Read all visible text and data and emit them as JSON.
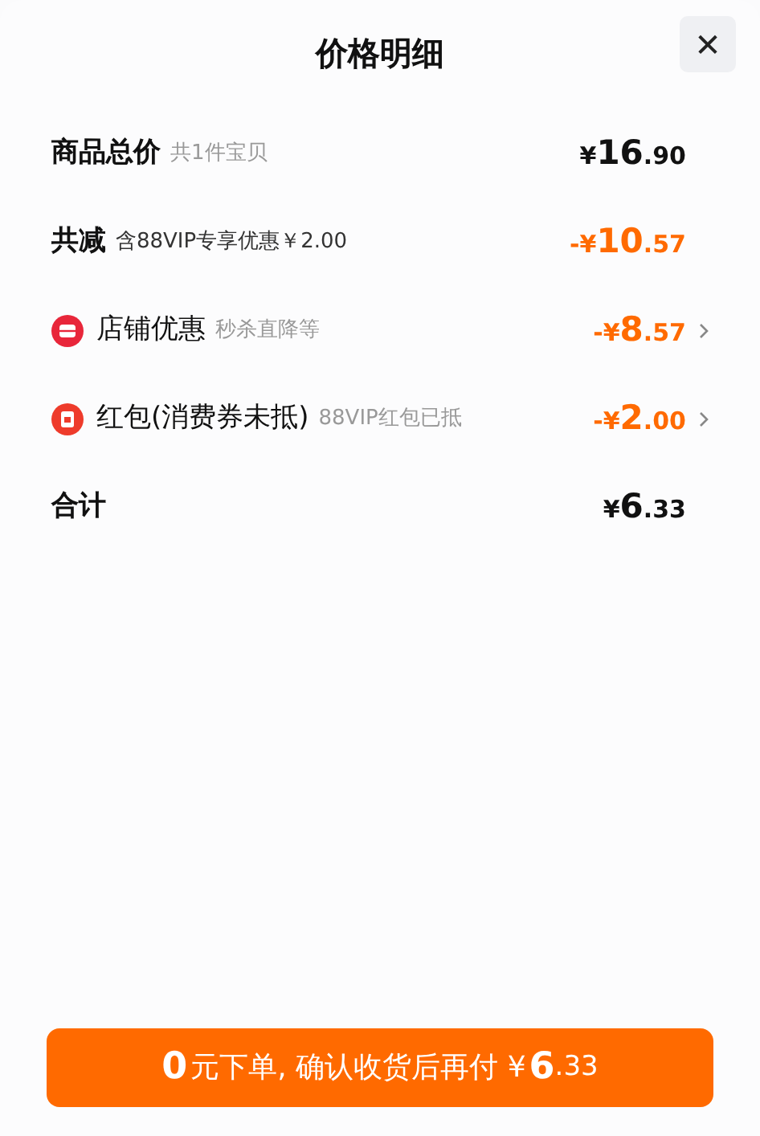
{
  "title": "价格明细",
  "close": {
    "label": "✕"
  },
  "rows": [
    {
      "kind": "plain",
      "label": "商品总价",
      "note": "共1件宝贝",
      "amount": {
        "currency": "¥",
        "integer": "16",
        "fraction": ".90"
      },
      "highlight": false,
      "chevron": false
    },
    {
      "kind": "plain",
      "label": "共减",
      "note": "含88VIP专享优惠￥2.00",
      "amount": {
        "sign": "-",
        "currency": "¥",
        "integer": "10",
        "fraction": ".57"
      },
      "highlight": true,
      "chevron": false
    },
    {
      "kind": "shop",
      "label": "店铺优惠",
      "note": "秒杀直降等",
      "amount": {
        "sign": "-",
        "currency": "¥",
        "integer": "8",
        "fraction": ".57"
      },
      "highlight": true,
      "chevron": true
    },
    {
      "kind": "redpacket",
      "label": "红包(消费券未抵)",
      "note": "88VIP红包已抵",
      "amount": {
        "sign": "-",
        "currency": "¥",
        "integer": "2",
        "fraction": ".00"
      },
      "highlight": true,
      "chevron": true
    },
    {
      "kind": "total",
      "label": "合计",
      "amount": {
        "currency": "¥",
        "integer": "6",
        "fraction": ".33"
      },
      "highlight": false,
      "chevron": false
    }
  ],
  "button": {
    "lead": "0",
    "text": "元下单, 确认收货后再付 ¥",
    "integer": "6",
    "fraction": ".33"
  }
}
